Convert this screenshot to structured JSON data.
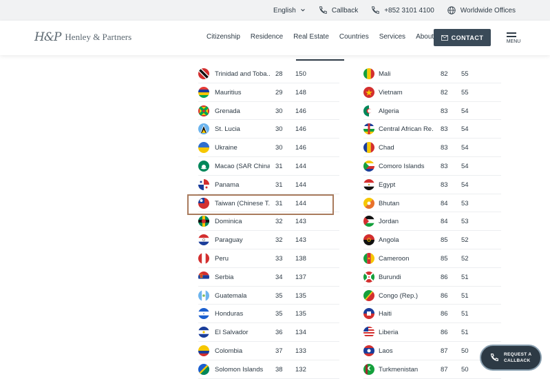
{
  "topbar": {
    "language": "English",
    "callback": "Callback",
    "phone": "+852 3101 4100",
    "offices": "Worldwide Offices"
  },
  "header": {
    "logo_mark": "H&P",
    "logo_text": "Henley & Partners",
    "nav": [
      "Citizenship",
      "Residence",
      "Real Estate",
      "Countries",
      "Services",
      "About"
    ],
    "contact_label": "CONTACT",
    "menu_label": "MENU"
  },
  "table_left": [
    {
      "name": "Trinidad and Toba...",
      "rank": "28",
      "score": "150",
      "flag": "trinidad"
    },
    {
      "name": "Mauritius",
      "rank": "29",
      "score": "148",
      "flag": "mauritius"
    },
    {
      "name": "Grenada",
      "rank": "30",
      "score": "146",
      "flag": "grenada"
    },
    {
      "name": "St. Lucia",
      "rank": "30",
      "score": "146",
      "flag": "stlucia"
    },
    {
      "name": "Ukraine",
      "rank": "30",
      "score": "146",
      "flag": "ukraine"
    },
    {
      "name": "Macao (SAR China)",
      "rank": "31",
      "score": "144",
      "flag": "macao"
    },
    {
      "name": "Panama",
      "rank": "31",
      "score": "144",
      "flag": "panama"
    },
    {
      "name": "Taiwan (Chinese T...",
      "rank": "31",
      "score": "144",
      "flag": "taiwan"
    },
    {
      "name": "Dominica",
      "rank": "32",
      "score": "143",
      "flag": "dominica"
    },
    {
      "name": "Paraguay",
      "rank": "32",
      "score": "143",
      "flag": "paraguay"
    },
    {
      "name": "Peru",
      "rank": "33",
      "score": "138",
      "flag": "peru"
    },
    {
      "name": "Serbia",
      "rank": "34",
      "score": "137",
      "flag": "serbia"
    },
    {
      "name": "Guatemala",
      "rank": "35",
      "score": "135",
      "flag": "guatemala"
    },
    {
      "name": "Honduras",
      "rank": "35",
      "score": "135",
      "flag": "honduras"
    },
    {
      "name": "El Salvador",
      "rank": "36",
      "score": "134",
      "flag": "elsalvador"
    },
    {
      "name": "Colombia",
      "rank": "37",
      "score": "133",
      "flag": "colombia"
    },
    {
      "name": "Solomon Islands",
      "rank": "38",
      "score": "132",
      "flag": "solomon"
    }
  ],
  "table_right": [
    {
      "name": "Mali",
      "rank": "82",
      "score": "55",
      "flag": "mali"
    },
    {
      "name": "Vietnam",
      "rank": "82",
      "score": "55",
      "flag": "vietnam"
    },
    {
      "name": "Algeria",
      "rank": "83",
      "score": "54",
      "flag": "algeria"
    },
    {
      "name": "Central African Re...",
      "rank": "83",
      "score": "54",
      "flag": "car"
    },
    {
      "name": "Chad",
      "rank": "83",
      "score": "54",
      "flag": "chad"
    },
    {
      "name": "Comoro Islands",
      "rank": "83",
      "score": "54",
      "flag": "comoros"
    },
    {
      "name": "Egypt",
      "rank": "83",
      "score": "54",
      "flag": "egypt"
    },
    {
      "name": "Bhutan",
      "rank": "84",
      "score": "53",
      "flag": "bhutan"
    },
    {
      "name": "Jordan",
      "rank": "84",
      "score": "53",
      "flag": "jordan"
    },
    {
      "name": "Angola",
      "rank": "85",
      "score": "52",
      "flag": "angola"
    },
    {
      "name": "Cameroon",
      "rank": "85",
      "score": "52",
      "flag": "cameroon"
    },
    {
      "name": "Burundi",
      "rank": "86",
      "score": "51",
      "flag": "burundi"
    },
    {
      "name": "Congo (Rep.)",
      "rank": "86",
      "score": "51",
      "flag": "congo"
    },
    {
      "name": "Haiti",
      "rank": "86",
      "score": "51",
      "flag": "haiti"
    },
    {
      "name": "Liberia",
      "rank": "86",
      "score": "51",
      "flag": "liberia"
    },
    {
      "name": "Laos",
      "rank": "87",
      "score": "50",
      "flag": "laos"
    },
    {
      "name": "Turkmenistan",
      "rank": "87",
      "score": "50",
      "flag": "turkmenistan"
    }
  ],
  "callback_float": {
    "line1": "REQUEST A",
    "line2": "CALLBACK"
  },
  "colors": {
    "accent": "#3a4a58",
    "highlight": "#a87a5c"
  }
}
